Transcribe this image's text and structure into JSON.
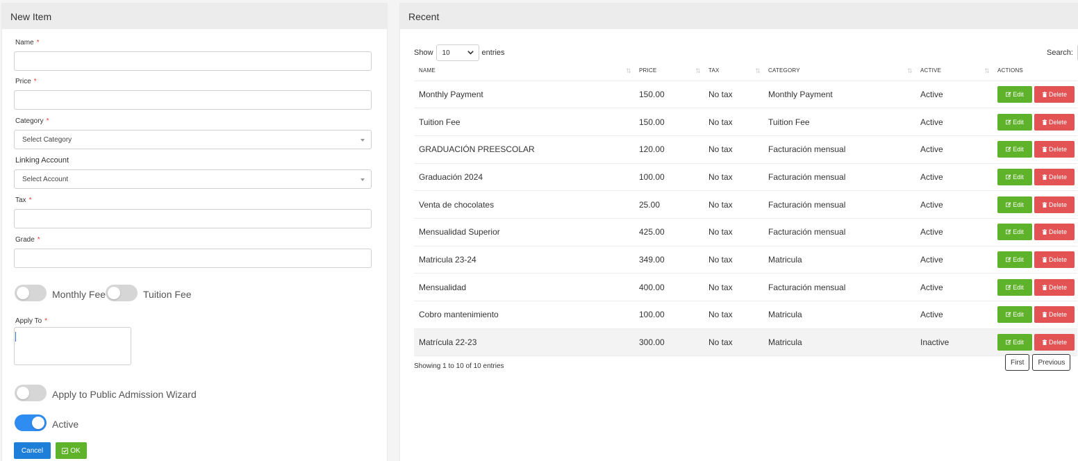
{
  "left_panel": {
    "title": "New Item",
    "fields": {
      "name_label": "Name",
      "price_label": "Price",
      "category_label": "Category",
      "category_placeholder": "Select Category",
      "linking_label": "Linking Account",
      "linking_placeholder": "Select Account",
      "tax_label": "Tax",
      "grade_label": "Grade",
      "apply_to_label": "Apply To",
      "required_mark": "*"
    },
    "toggles": {
      "monthly_fee": "Monthly Fee",
      "tuition_fee": "Tuition Fee",
      "public_admission": "Apply to Public Admission Wizard",
      "active": "Active"
    },
    "buttons": {
      "cancel": "Cancel",
      "ok": "OK"
    }
  },
  "right_panel": {
    "title": "Recent",
    "show_label": "Show",
    "entries_value": "10",
    "entries_label": "entries",
    "search_label": "Search:",
    "columns": [
      "NAME",
      "PRICE",
      "TAX",
      "CATEGORY",
      "ACTIVE",
      "ACTIONS"
    ],
    "rows": [
      {
        "name": "Monthly Payment",
        "price": "150.00",
        "tax": "No tax",
        "category": "Monthly Payment",
        "active": "Active"
      },
      {
        "name": "Tuition Fee",
        "price": "150.00",
        "tax": "No tax",
        "category": "Tuition Fee",
        "active": "Active"
      },
      {
        "name": "GRADUACIÓN PREESCOLAR",
        "price": "120.00",
        "tax": "No tax",
        "category": "Facturación mensual",
        "active": "Active"
      },
      {
        "name": "Graduación 2024",
        "price": "100.00",
        "tax": "No tax",
        "category": "Facturación mensual",
        "active": "Active"
      },
      {
        "name": "Venta de chocolates",
        "price": "25.00",
        "tax": "No tax",
        "category": "Facturación mensual",
        "active": "Active"
      },
      {
        "name": "Mensualidad Superior",
        "price": "425.00",
        "tax": "No tax",
        "category": "Facturación mensual",
        "active": "Active"
      },
      {
        "name": "Matricula 23-24",
        "price": "349.00",
        "tax": "No tax",
        "category": "Matricula",
        "active": "Active"
      },
      {
        "name": "Mensualidad",
        "price": "400.00",
        "tax": "No tax",
        "category": "Facturación mensual",
        "active": "Active"
      },
      {
        "name": "Cobro mantenimiento",
        "price": "100.00",
        "tax": "No tax",
        "category": "Matricula",
        "active": "Active"
      },
      {
        "name": "Matrícula 22-23",
        "price": "300.00",
        "tax": "No tax",
        "category": "Matricula",
        "active": "Inactive"
      }
    ],
    "edit_label": "Edit",
    "delete_label": "Delete",
    "info": "Showing 1 to 10 of 10 entries",
    "pager": {
      "first": "First",
      "previous": "Previous"
    }
  },
  "colors": {
    "primary": "#1e7fd8",
    "success": "#5fb32a",
    "danger": "#e45353",
    "toggle_on": "#2f8cf0"
  },
  "icons": {
    "edit": "edit-icon",
    "delete": "trash-icon",
    "ok": "check-square-icon"
  }
}
